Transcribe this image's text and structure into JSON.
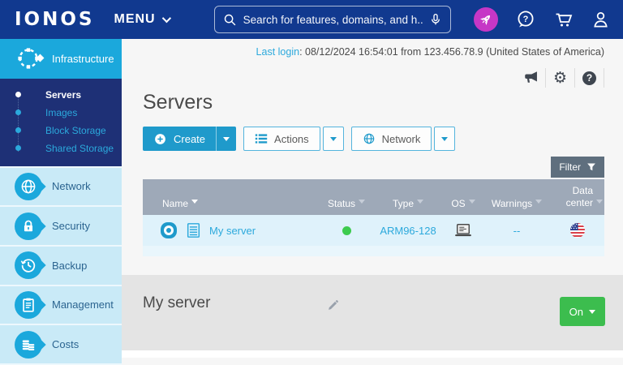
{
  "topbar": {
    "logo": "IONOS",
    "menu": "MENU",
    "search": {
      "placeholder": "Search for features, domains, and h..."
    }
  },
  "glyphs": {
    "question": "?",
    "gear": "⚙"
  },
  "sidebar": {
    "active_section": {
      "label": "Infrastructure"
    },
    "submenu": [
      {
        "label": "Servers"
      },
      {
        "label": "Images"
      },
      {
        "label": "Block Storage"
      },
      {
        "label": "Shared Storage"
      }
    ],
    "sections": [
      {
        "label": "Network"
      },
      {
        "label": "Security"
      },
      {
        "label": "Backup"
      },
      {
        "label": "Management"
      },
      {
        "label": "Costs"
      }
    ]
  },
  "header": {
    "last_login_label": "Last login",
    "last_login_rest": ": 08/12/2024 16:54:01 from 123.456.78.9 (United States of America)"
  },
  "page": {
    "title": "Servers"
  },
  "toolbar": {
    "create": "Create",
    "actions": "Actions",
    "network": "Network",
    "filter": "Filter"
  },
  "table": {
    "headers": {
      "name": "Name",
      "status": "Status",
      "type": "Type",
      "os": "OS",
      "warnings": "Warnings",
      "datacenter": "Data center"
    },
    "row": {
      "name": "My server",
      "status": "on",
      "type": "ARM96-128",
      "os": "laptop-os",
      "warnings": "--",
      "datacenter": "United States of America"
    }
  },
  "panel": {
    "title": "My server",
    "power_state": "On"
  },
  "colors": {
    "topbar_blue": "#11398F",
    "accent_teal": "#1BA8DC",
    "link_teal": "#2CA9DC",
    "nav_navy": "#1E3076",
    "table_header": "#9EA9B8",
    "row_blue": "#DFF2FB",
    "status_green": "#3DCB4E",
    "power_green": "#3CBD4E",
    "rocket_magenta": "#C637C6",
    "filter_slate": "#5F6F7E"
  }
}
